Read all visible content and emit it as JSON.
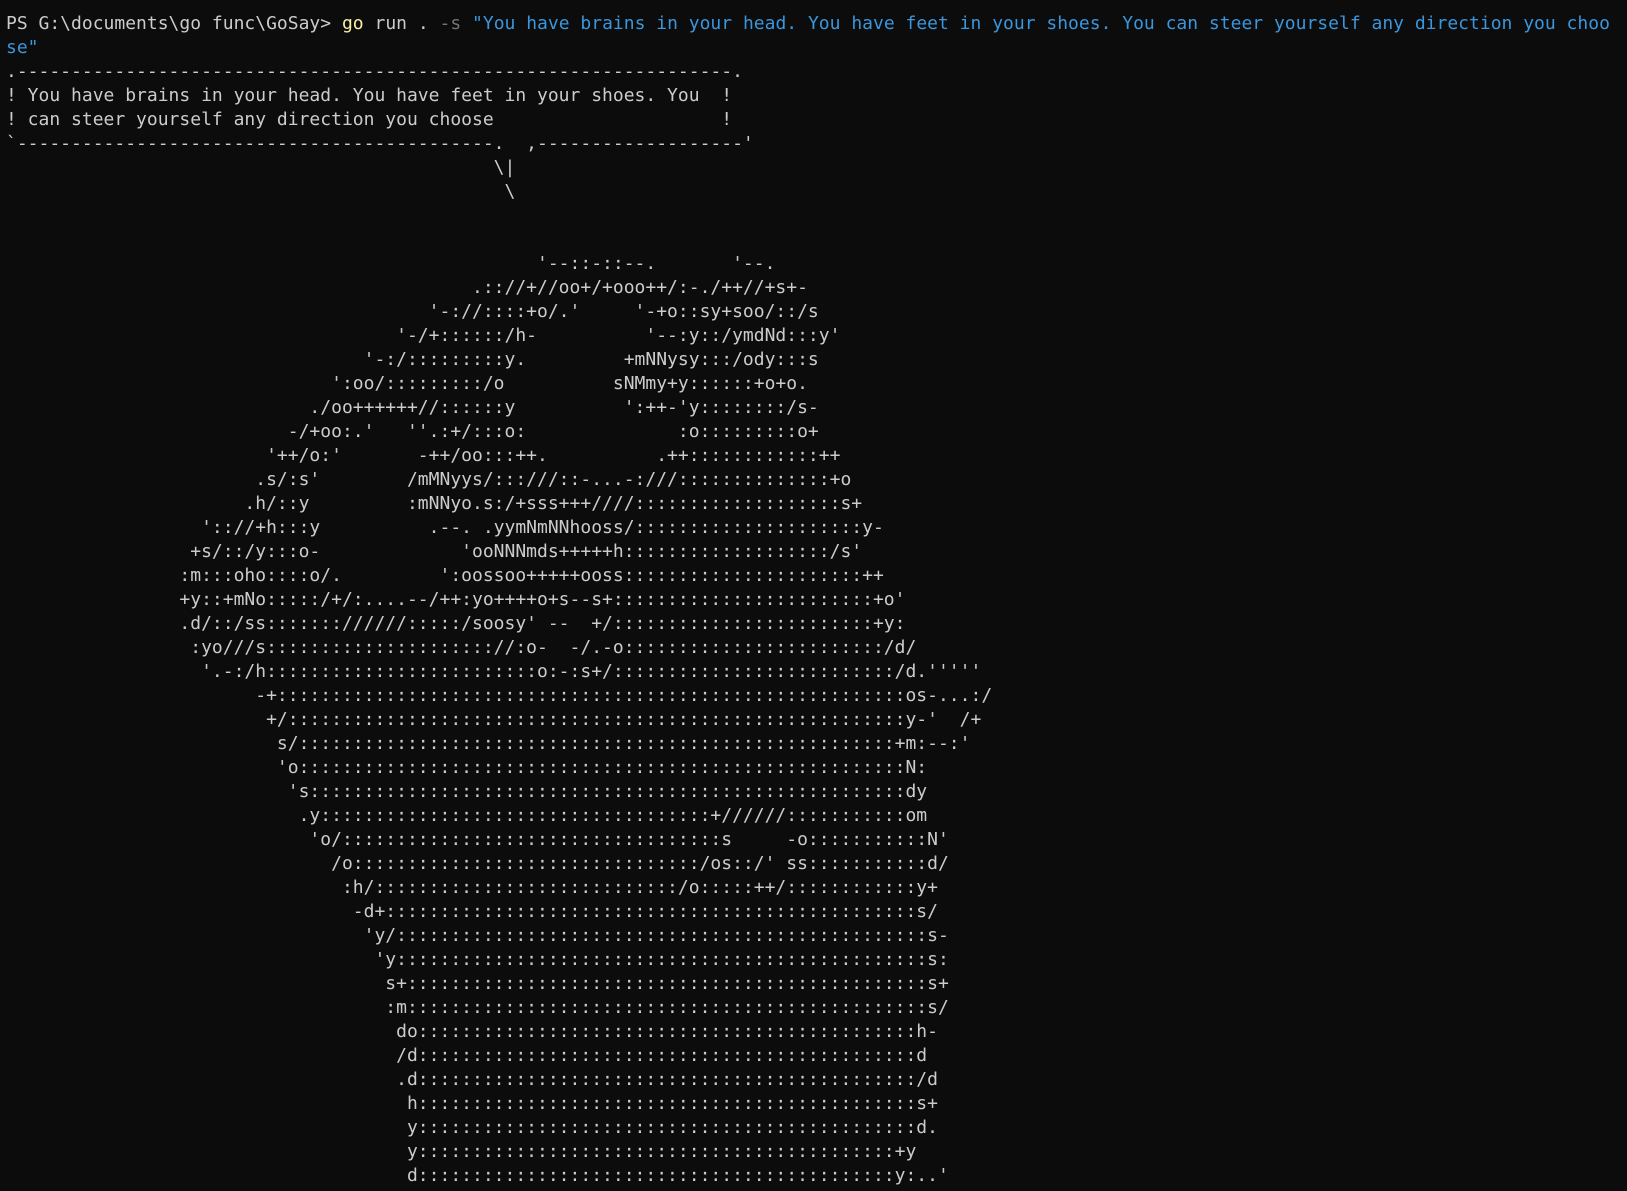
{
  "prompt": {
    "text": "PS G:\\documents\\go func\\GoSay> ",
    "command": "go",
    "arg1": " run . ",
    "flag": "-s",
    "string_arg": " \"You have brains in your head. You have feet in your shoes. You can steer yourself any direction you choose\""
  },
  "speech_bubble": [
    ".------------------------------------------------------------------.",
    "! You have brains in your head. You have feet in your shoes. You  !",
    "! can steer yourself any direction you choose                     !",
    "`--------------------------------------------.  ,-------------------'",
    "                                             \\|",
    "                                              \\"
  ],
  "ascii_art": [
    "",
    "",
    "                                                 '--::-::--.       '--.",
    "                                           .:://+//oo+/+ooo++/:-./++//+s+-",
    "                                       '-://::::+o/.'     '-+o::sy+soo/::/s",
    "                                    '-/+::::::/h-          '--:y::/ymdNd:::y'",
    "                                 '-:/:::::::::y.         +mNNysy:::/ody:::s",
    "                              ':oo/:::::::::/o          sNMmy+y::::::+o+o.",
    "                            ./oo++++++//::::::y          ':++-'y::::::::/s-",
    "                          -/+oo:.'   ''.:+/:::o:              :o:::::::::o+",
    "                        '++/o:'       -++/oo:::++.          .++::::::::::::++",
    "                       .s/:s'        /mMNyys/:::///::-...-:///::::::::::::::+o",
    "                      .h/::y         :mNNyo.s:/+sss+++////:::::::::::::::::::s+",
    "                  ':://+h:::y          .--. .yymNmNNhooss/:::::::::::::::::::::y-",
    "                 +s/::/y:::o-             'ooNNNmds+++++h:::::::::::::::::::/s'",
    "                :m:::oho::::o/.         ':oossoo+++++ooss::::::::::::::::::::::++",
    "                +y::+mNo:::::/+/:....--/++:yo++++o+s--s+::::::::::::::::::::::::+o'",
    "                .d/::/ss::::::://////:::::/soosy' --  +/::::::::::::::::::::::::+y:",
    "                 :yo///s::::::::::::::::::::://:o-  -/.-o::::::::::::::::::::::::/d/",
    "                  '.-:/h:::::::::::::::::::::::::o:-:s+/::::::::::::::::::::::::::/d.'''''",
    "                       -+::::::::::::::::::::::::::::::::::::::::::::::::::::::::::os-...:/",
    "                        +/:::::::::::::::::::::::::::::::::::::::::::::::::::::::::y-'  /+",
    "                         s/:::::::::::::::::::::::::::::::::::::::::::::::::::::::+m:--:'",
    "                         'o::::::::::::::::::::::::::::::::::::::::::::::::::::::::N:",
    "                          's:::::::::::::::::::::::::::::::::::::::::::::::::::::::dy",
    "                           .y::::::::::::::::::::::::::::::::::::+//////:::::::::::om",
    "                            'o/:::::::::::::::::::::::::::::::::::s     -o:::::::::::N'",
    "                              /o::::::::::::::::::::::::::::::::/os::/' ss:::::::::::d/",
    "                               :h/::::::::::::::::::::::::::::/o:::::++/::::::::::::y+",
    "                                -d+:::::::::::::::::::::::::::::::::::::::::::::::::s/",
    "                                 'y/:::::::::::::::::::::::::::::::::::::::::::::::::s-",
    "                                  'y:::::::::::::::::::::::::::::::::::::::::::::::::s:",
    "                                   s+::::::::::::::::::::::::::::::::::::::::::::::::s+",
    "                                   :m::::::::::::::::::::::::::::::::::::::::::::::::s/",
    "                                    do::::::::::::::::::::::::::::::::::::::::::::::h-",
    "                                    /d::::::::::::::::::::::::::::::::::::::::::::::d",
    "                                    .d::::::::::::::::::::::::::::::::::::::::::::::/d",
    "                                     h::::::::::::::::::::::::::::::::::::::::::::::s+",
    "                                     y::::::::::::::::::::::::::::::::::::::::::::::d.",
    "                                     y::::::::::::::::::::::::::::::::::::::::::::+y",
    "                                     d::::::::::::::::::::::::::::::::::::::::::::y:..'"
  ]
}
